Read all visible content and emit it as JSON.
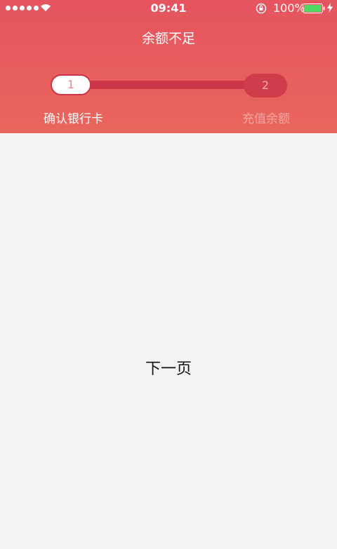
{
  "status_bar": {
    "time": "09:41",
    "battery_percent": "100%",
    "battery_level": 1.0,
    "signal_bars": 5
  },
  "header": {
    "title": "余额不足"
  },
  "stepper": {
    "steps": [
      {
        "number": "1",
        "label": "确认银行卡",
        "active": true
      },
      {
        "number": "2",
        "label": "充值余额",
        "active": false
      }
    ]
  },
  "main": {
    "next_page_label": "下一页"
  },
  "colors": {
    "header_gradient_top": "#e6545f",
    "header_gradient_bottom": "#e9665c",
    "track": "#cc3545",
    "background": "#f3f2f5"
  }
}
